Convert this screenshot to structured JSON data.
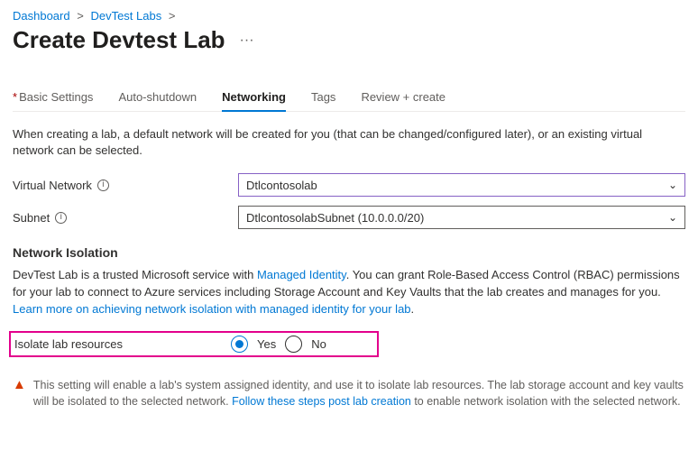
{
  "breadcrumb": {
    "items": [
      "Dashboard",
      "DevTest Labs"
    ]
  },
  "page_title": "Create Devtest Lab",
  "tabs": {
    "items": [
      {
        "label": "Basic Settings",
        "required": true
      },
      {
        "label": "Auto-shutdown"
      },
      {
        "label": "Networking",
        "active": true
      },
      {
        "label": "Tags"
      },
      {
        "label": "Review + create"
      }
    ]
  },
  "description": "When creating a lab, a default network will be created for you (that can be changed/configured later), or an existing virtual network can be selected.",
  "fields": {
    "vnet": {
      "label": "Virtual Network",
      "value": "Dtlcontosolab"
    },
    "subnet": {
      "label": "Subnet",
      "value": "DtlcontosolabSubnet (10.0.0.0/20)"
    }
  },
  "network_isolation": {
    "header": "Network Isolation",
    "text_before_link1": "DevTest Lab is a trusted Microsoft service with ",
    "link1": "Managed Identity",
    "text_mid": ". You can grant Role-Based Access Control (RBAC) permissions for your lab to connect to Azure services including Storage Account and Key Vaults that the lab creates and manages for you. ",
    "link2": "Learn more on achieving network isolation with managed identity for your lab",
    "period": "."
  },
  "isolate": {
    "label": "Isolate lab resources",
    "yes": "Yes",
    "no": "No",
    "selected": "yes"
  },
  "alert": {
    "text_before": "This setting will enable a lab's system assigned identity, and use it to isolate lab resources. The lab storage account and key vaults will be isolated to the selected network. ",
    "link": "Follow these steps post lab creation",
    "text_after": " to enable network isolation with the selected network."
  }
}
